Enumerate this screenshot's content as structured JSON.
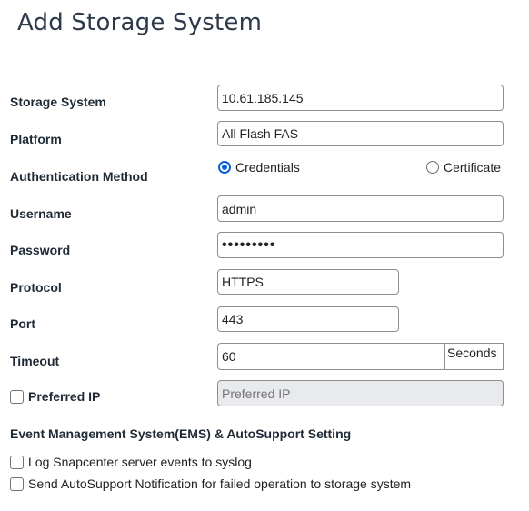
{
  "dialog": {
    "title": "Add Storage System"
  },
  "fields": {
    "storage_system": {
      "label": "Storage System",
      "value": "10.61.185.145"
    },
    "platform": {
      "label": "Platform",
      "value": "All Flash FAS"
    },
    "auth_method": {
      "label": "Authentication Method",
      "options": [
        {
          "label": "Credentials",
          "selected": true
        },
        {
          "label": "Certificate",
          "selected": false
        }
      ]
    },
    "username": {
      "label": "Username",
      "value": "admin"
    },
    "password": {
      "label": "Password",
      "value": "•••••••••"
    },
    "protocol": {
      "label": "Protocol",
      "value": "HTTPS"
    },
    "port": {
      "label": "Port",
      "value": "443"
    },
    "timeout": {
      "label": "Timeout",
      "value": "60",
      "unit": "Seconds"
    },
    "preferred_ip": {
      "label": "Preferred IP",
      "checked": false,
      "placeholder": "Preferred IP"
    }
  },
  "ems": {
    "heading": "Event Management System(EMS) & AutoSupport Setting",
    "options": [
      {
        "label": "Log Snapcenter server events to syslog",
        "checked": false
      },
      {
        "label": "Send AutoSupport Notification for failed operation to storage system",
        "checked": false
      }
    ]
  },
  "colors": {
    "accent": "#0b5fd6",
    "label_text": "#1f2a36",
    "disabled_bg": "#e8eaed"
  }
}
